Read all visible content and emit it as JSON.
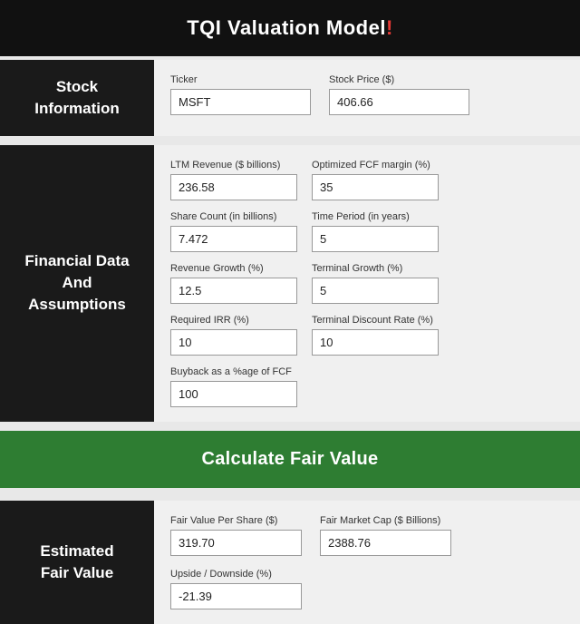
{
  "header": {
    "title": "TQI Valuation Model",
    "title_main": "TQI Valuation Model",
    "red_char": "!"
  },
  "stock_section": {
    "label": "Stock\nInformation",
    "fields": [
      {
        "label": "Ticker",
        "value": "MSFT",
        "name": "ticker"
      },
      {
        "label": "Stock Price ($)",
        "value": "406.66",
        "name": "stock-price"
      }
    ]
  },
  "financial_section": {
    "label": "Financial Data\nAnd\nAssumptions",
    "rows": [
      [
        {
          "label": "LTM Revenue ($ billions)",
          "value": "236.58",
          "name": "ltm-revenue"
        },
        {
          "label": "Optimized FCF margin (%)",
          "value": "35",
          "name": "fcf-margin"
        },
        {
          "label": "Share Count (in billions)",
          "value": "7.472",
          "name": "share-count"
        }
      ],
      [
        {
          "label": "Time Period (in years)",
          "value": "5",
          "name": "time-period"
        },
        {
          "label": "Revenue Growth (%)",
          "value": "12.5",
          "name": "revenue-growth"
        },
        {
          "label": "Terminal Growth (%)",
          "value": "5",
          "name": "terminal-growth"
        }
      ],
      [
        {
          "label": "Required IRR (%)",
          "value": "10",
          "name": "required-irr"
        },
        {
          "label": "Terminal Discount Rate (%)",
          "value": "10",
          "name": "terminal-discount"
        },
        {
          "label": "Buyback as a %age of FCF",
          "value": "100",
          "name": "buyback-pct"
        }
      ]
    ]
  },
  "calculate_button": {
    "label": "Calculate Fair Value"
  },
  "fair_value_section": {
    "label": "Estimated\nFair Value",
    "fields": [
      {
        "label": "Fair Value Per Share ($)",
        "value": "319.70",
        "name": "fair-value-per-share"
      },
      {
        "label": "Fair Market Cap ($ Billions)",
        "value": "2388.76",
        "name": "fair-market-cap"
      },
      {
        "label": "Upside / Downside (%)",
        "value": "-21.39",
        "name": "upside-downside"
      }
    ]
  }
}
